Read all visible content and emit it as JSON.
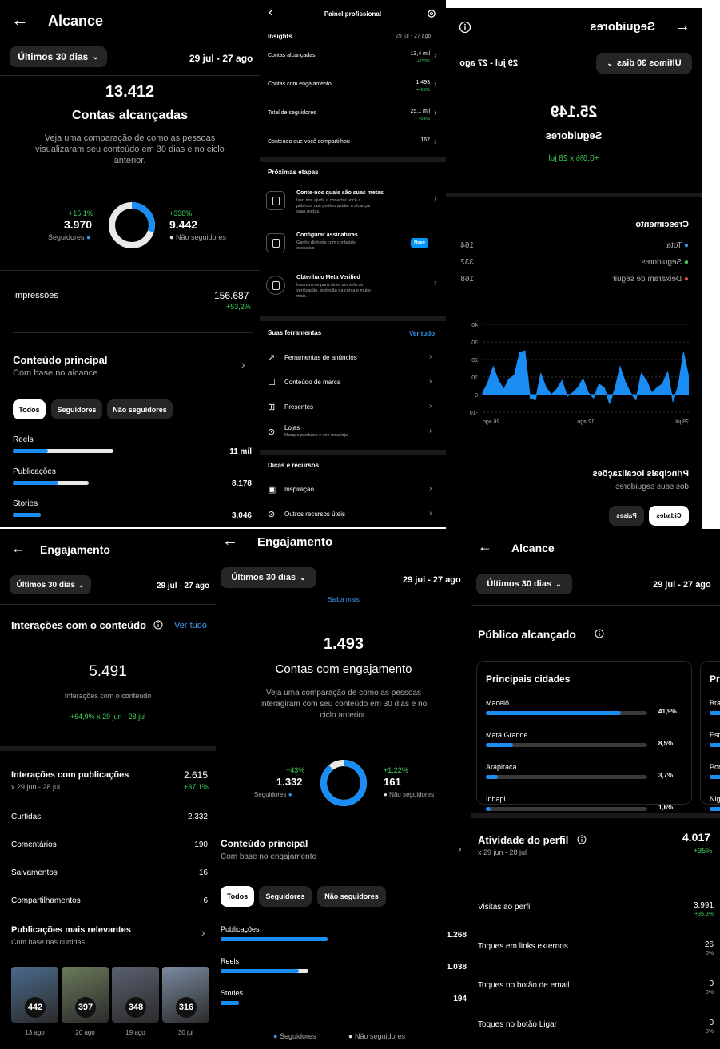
{
  "p1": {
    "title": "Alcance",
    "range": "Últimos 30 dias",
    "dates": "29 jul - 27 ago",
    "big": "13.412",
    "big_label": "Contas alcançadas",
    "desc1": "Veja uma comparação de como as pessoas",
    "desc2": "visualizaram seu conteúdo em 30 dias e no ciclo",
    "desc3": "anterior.",
    "fol_pct": "+15,1%",
    "fol_val": "3.970",
    "fol_lbl": "Seguidores",
    "non_pct": "+338%",
    "non_val": "9.442",
    "non_lbl": "Não seguidores",
    "follower_share": 0.3,
    "imp_lbl": "Impressões",
    "imp_val": "156.687",
    "imp_pct": "+53,2%",
    "main_title": "Conteúdo principal",
    "main_sub": "Com base no alcance",
    "tabs": [
      "Todos",
      "Seguidores",
      "Não seguidores"
    ],
    "rows": [
      {
        "label": "Reels",
        "value": "11 mil",
        "f": 0.35,
        "t": 1.0
      },
      {
        "label": "Publicações",
        "value": "8.178",
        "f": 0.45,
        "t": 0.75
      },
      {
        "label": "Stories",
        "value": "3.046",
        "f": 0.28,
        "t": 0.28
      }
    ]
  },
  "p2": {
    "title": "Painel profissional",
    "ins": "Insights",
    "ins_dates": "29 jul - 27 ago",
    "metrics": [
      {
        "label": "Contas alcançadas",
        "value": "13,4 mil",
        "delta": "+152%"
      },
      {
        "label": "Contas com engajamento",
        "value": "1.493",
        "delta": "+46,3%"
      },
      {
        "label": "Total de seguidores",
        "value": "25,1 mil",
        "delta": "+0,6%"
      },
      {
        "label": "Conteúdo que você compartilhou",
        "value": "167",
        "delta": ""
      }
    ],
    "next": "Próximas etapas",
    "steps": [
      {
        "title": "Conte-nos quais são suas metas",
        "d1": "Isso nos ajuda a conectar você a",
        "d2": "públicos que podem ajudar a alcançar",
        "d3": "suas metas."
      },
      {
        "title": "Configurar assinaturas",
        "d1": "Ganhe dinheiro com conteúdo",
        "d2": "exclusivo",
        "d3": "",
        "badge": "Novo"
      },
      {
        "title": "Obtenha o Meta Verified",
        "d1": "Inscreva-se para obter um selo de",
        "d2": "verificação, proteção da conta e muito",
        "d3": "mais."
      }
    ],
    "tools": "Suas ferramentas",
    "see_all": "Ver tudo",
    "tool_items": [
      {
        "label": "Ferramentas de anúncios",
        "sub": ""
      },
      {
        "label": "Conteúdo de marca",
        "sub": ""
      },
      {
        "label": "Presentes",
        "sub": ""
      },
      {
        "label": "Lojas",
        "sub": "Marque produtos e crie uma loja"
      }
    ],
    "tips": "Dicas e recursos",
    "tip_items": [
      "Inspiração",
      "Outros recursos úteis"
    ]
  },
  "p3": {
    "title": "Seguidores",
    "range": "Últimos 30 dias",
    "dates": "29 jul - 27 ago",
    "big": "25.149",
    "big_label": "Seguidores",
    "delta": "+0,6% x 28 jul",
    "growth": "Crescimento",
    "legend": [
      {
        "label": "Total",
        "value": "164",
        "color": "#3897f0"
      },
      {
        "label": "Seguidores",
        "value": "332",
        "color": "#3ecf5b"
      },
      {
        "label": "Deixaram de seguir",
        "value": "168",
        "color": "#ed4956"
      }
    ],
    "y_ticks": [
      "40",
      "30",
      "20",
      "10",
      "0",
      "-10"
    ],
    "x_ticks": [
      "29 jul",
      "12 ago",
      "26 ago"
    ],
    "series": [
      10,
      24,
      5,
      -4,
      13,
      6,
      4,
      1,
      8,
      12,
      -3,
      1,
      7,
      16,
      3,
      -5,
      4,
      6,
      -2,
      1,
      9,
      4,
      1,
      -1,
      8,
      3,
      0,
      4,
      12,
      -3,
      -2,
      25,
      24,
      11,
      9,
      3,
      8,
      16,
      7,
      1
    ],
    "loc_title": "Principais localizações",
    "loc_sub": "dos seus seguidores",
    "loc_tabs": [
      "Cidades",
      "Países"
    ]
  },
  "p4": {
    "title": "Engajamento",
    "range": "Últimos 30 dias",
    "dates": "29 jul - 27 ago",
    "inter_title": "Interações com o conteúdo",
    "see_all": "Ver tudo",
    "big": "5.491",
    "big_label": "Interações com o conteúdo",
    "delta": "+64,9% x 29 jun - 28 jul",
    "pub_title": "Interações com publicações",
    "pub_sub": "x 29 jun - 28 jul",
    "pub_val": "2.615",
    "pub_pct": "+37,1%",
    "rows": [
      {
        "label": "Curtidas",
        "value": "2.332"
      },
      {
        "label": "Comentários",
        "value": "190"
      },
      {
        "label": "Salvamentos",
        "value": "16"
      },
      {
        "label": "Compartilhamentos",
        "value": "6"
      }
    ],
    "top_title": "Publicações mais relevantes",
    "top_sub": "Com base nas curtidas",
    "thumbs": [
      {
        "count": "442",
        "date": "13 ago"
      },
      {
        "count": "397",
        "date": "20 ago"
      },
      {
        "count": "348",
        "date": "19 ago"
      },
      {
        "count": "316",
        "date": "30 jul"
      }
    ]
  },
  "p5": {
    "title": "Engajamento",
    "range": "Últimos 30 dias",
    "dates": "29 jul - 27 ago",
    "saiba": "Saiba mais",
    "big": "1.493",
    "big_label": "Contas com engajamento",
    "desc1": "Veja uma comparação de como as pessoas",
    "desc2": "interagiram com seu conteúdo em 30 dias e no",
    "desc3": "ciclo anterior.",
    "fol_pct": "+43%",
    "fol_val": "1.332",
    "fol_lbl": "Seguidores",
    "non_pct": "+1,22%",
    "non_val": "161",
    "non_lbl": "Não seguidores",
    "follower_share": 0.89,
    "main_title": "Conteúdo principal",
    "main_sub": "Com base no engajamento",
    "tabs": [
      "Todos",
      "Seguidores",
      "Não seguidores"
    ],
    "rows": [
      {
        "label": "Publicações",
        "value": "1.268",
        "f": 1.0,
        "t": 1.0
      },
      {
        "label": "Reels",
        "value": "1.038",
        "f": 0.73,
        "t": 0.82
      },
      {
        "label": "Stories",
        "value": "194",
        "f": 0.17,
        "t": 0.17
      }
    ],
    "legend": [
      "Seguidores",
      "Não seguidores"
    ]
  },
  "p6": {
    "title": "Alcance",
    "range": "Últimos 30 dias",
    "dates": "29 jul - 27 ago",
    "pub_title": "Público alcançado",
    "cities_title": "Principais cidades",
    "cities": [
      {
        "name": "Maceió",
        "pct": "41,9%",
        "v": 0.419
      },
      {
        "name": "Mata Grande",
        "pct": "8,5%",
        "v": 0.085
      },
      {
        "name": "Arapiraca",
        "pct": "3,7%",
        "v": 0.037
      },
      {
        "name": "Inhapi",
        "pct": "1,6%",
        "v": 0.016
      }
    ],
    "card2_title": "Pr",
    "card2_rows": [
      "Bra",
      "Est",
      "Por",
      "Nig"
    ],
    "act_title": "Atividade do perfil",
    "act_sub": "x 29 jun - 28 jul",
    "act_val": "4.017",
    "act_pct": "+35%",
    "act_rows": [
      {
        "label": "Visitas ao perfil",
        "value": "3.991",
        "pct": "+35,3%"
      },
      {
        "label": "Toques em links externos",
        "value": "26",
        "pct": "0%"
      },
      {
        "label": "Toques no botão de email",
        "value": "0",
        "pct": "0%"
      },
      {
        "label": "Toques no botão Ligar",
        "value": "0",
        "pct": "0%"
      }
    ]
  }
}
